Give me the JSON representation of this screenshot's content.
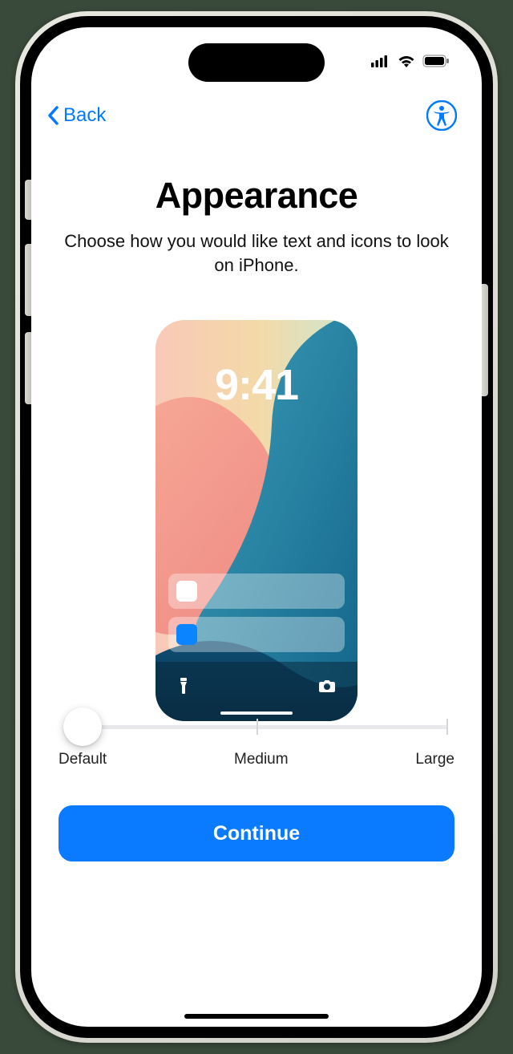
{
  "nav": {
    "back_label": "Back"
  },
  "header": {
    "title": "Appearance",
    "subtitle": "Choose how you would like text and icons to look on iPhone."
  },
  "preview": {
    "time": "9:41"
  },
  "slider": {
    "labels": {
      "left": "Default",
      "mid": "Medium",
      "right": "Large"
    },
    "selected_index": 0
  },
  "actions": {
    "continue_label": "Continue"
  }
}
